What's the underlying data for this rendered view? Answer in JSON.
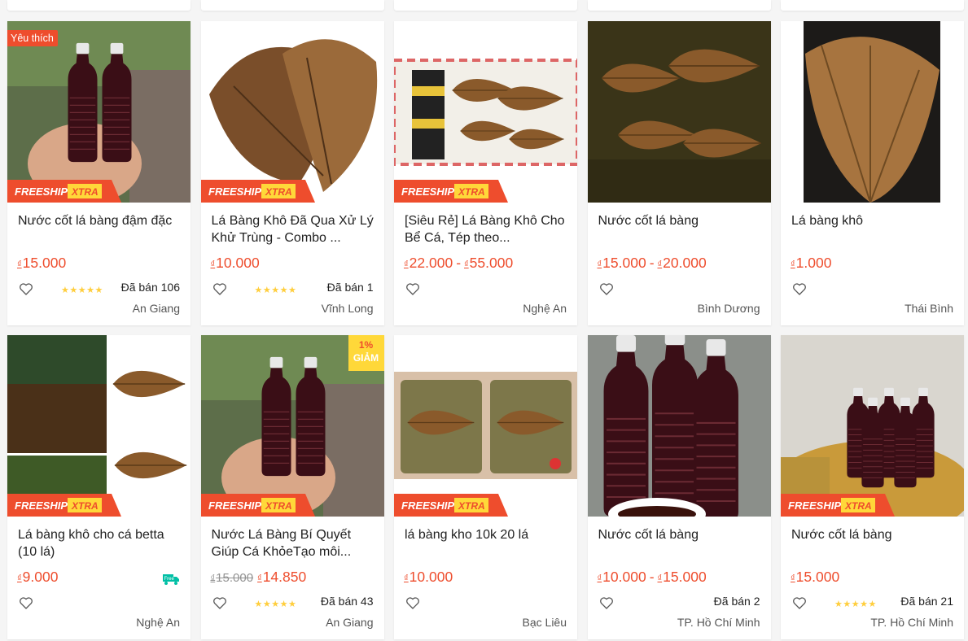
{
  "labels": {
    "favorite": "Yêu thích",
    "freeship": "FREESHIP",
    "xtra": "XTRA",
    "discount_label": "GIẢM",
    "currency": "₫",
    "free_ship_badge": "Free",
    "stars": "★★★★★"
  },
  "colors": {
    "accent": "#ee4d2d",
    "star": "#ffce3d",
    "discount_bg": "#ffd839",
    "freeship_yellow": "#ffd839"
  },
  "products": [
    {
      "name": "Nước cốt lá bàng đậm đặc",
      "price_min": "15.000",
      "sold": "Đã bán 106",
      "location": "An Giang"
    },
    {
      "name": "Lá Bàng Khô Đã Qua Xử Lý Khử Trùng - Combo ...",
      "price_min": "10.000",
      "sold": "Đã bán 1",
      "location": "Vĩnh Long"
    },
    {
      "name": "[Siêu Rẻ] Lá Bàng Khô Cho Bể Cá, Tép theo...",
      "price_min": "22.000",
      "price_max": "55.000",
      "location": "Nghệ An"
    },
    {
      "name": "Nước cốt lá bàng",
      "price_min": "15.000",
      "price_max": "20.000",
      "location": "Bình Dương"
    },
    {
      "name": "Lá bàng khô",
      "price_min": "1.000",
      "location": "Thái Bình"
    },
    {
      "name": "Lá bàng khô cho cá betta (10 lá)",
      "price_min": "9.000",
      "location": "Nghệ An"
    },
    {
      "name": "Nước Lá Bàng Bí Quyết Giúp Cá KhỏeTạo môi...",
      "original_price": "15.000",
      "price_min": "14.850",
      "discount": "1%",
      "sold": "Đã bán 43",
      "location": "An Giang"
    },
    {
      "name": "lá bàng kho 10k 20 lá",
      "price_min": "10.000",
      "location": "Bạc Liêu"
    },
    {
      "name": "Nước cốt lá bàng",
      "price_min": "10.000",
      "price_max": "15.000",
      "sold": "Đã bán 2",
      "location": "TP. Hồ Chí Minh"
    },
    {
      "name": "Nước cốt lá bàng",
      "price_min": "15.000",
      "sold": "Đã bán 21",
      "location": "TP. Hồ Chí Minh"
    }
  ]
}
